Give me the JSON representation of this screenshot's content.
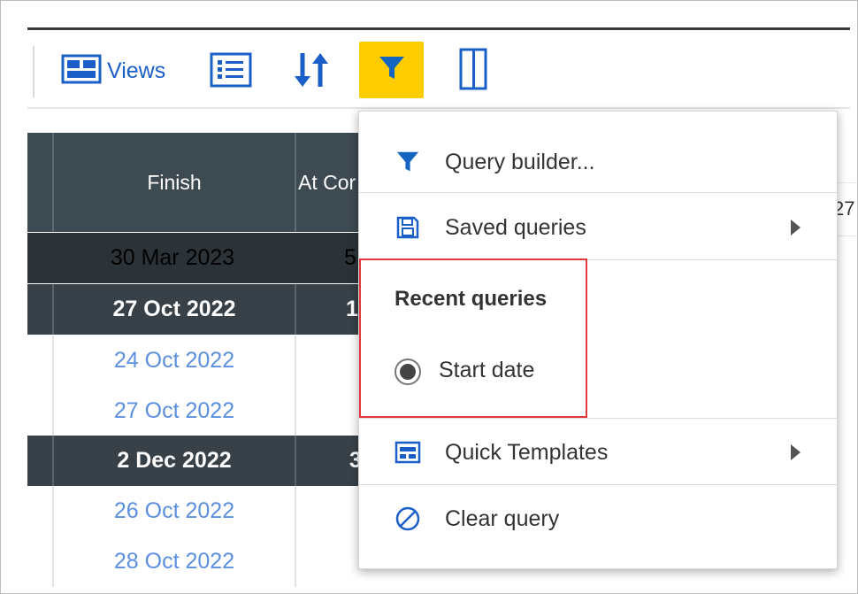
{
  "toolbar": {
    "views_label": "Views",
    "filter_active_color": "#ffcc00",
    "icons": [
      "views-icon",
      "list-icon",
      "sort-icon",
      "filter-icon",
      "columns-icon"
    ]
  },
  "grid": {
    "headers": [
      "Finish",
      "At Cor"
    ],
    "rows": [
      {
        "finish": "30 Mar 2023",
        "atcomp": "5",
        "style": "darker"
      },
      {
        "finish": "27 Oct 2022",
        "atcomp": "1",
        "style": "dark"
      },
      {
        "finish": "24 Oct 2022",
        "atcomp": "",
        "style": "light"
      },
      {
        "finish": "27 Oct 2022",
        "atcomp": "",
        "style": "light"
      },
      {
        "finish": "2 Dec 2022",
        "atcomp": "3",
        "style": "dark"
      },
      {
        "finish": "26 Oct 2022",
        "atcomp": "",
        "style": "light"
      },
      {
        "finish": "28 Oct 2022",
        "atcomp": "",
        "style": "light"
      }
    ],
    "right_partial": "27"
  },
  "menu": {
    "query_builder": "Query builder...",
    "saved_queries": "Saved queries",
    "recent_title": "Recent queries",
    "recent_item": "Start date",
    "quick_templates": "Quick Templates",
    "clear_query": "Clear query",
    "highlight_color": "#e0383d"
  }
}
